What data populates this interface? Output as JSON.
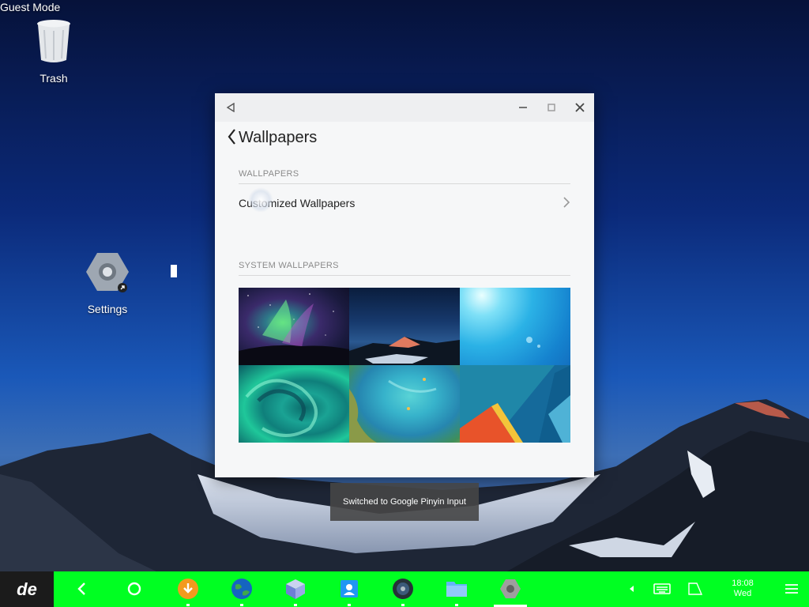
{
  "desktop": {
    "mode_label": "Guest Mode",
    "icons": [
      {
        "name": "trash",
        "label": "Trash"
      },
      {
        "name": "settings",
        "label": "Settings"
      }
    ]
  },
  "window": {
    "page_title": "Wallpapers",
    "sections": {
      "wallpapers_label": "WALLPAPERS",
      "customized_label": "Customized Wallpapers",
      "system_label": "SYSTEM WALLPAPERS"
    },
    "thumbnails": [
      "aurora-night",
      "mountain-sunset",
      "blue-sky-flare",
      "teal-wave",
      "ocean-aerial",
      "material-geometric"
    ]
  },
  "toast": {
    "text": "Switched to Google Pinyin Input"
  },
  "taskbar": {
    "start_label": "de",
    "apps": [
      "back-arrow",
      "home-circle",
      "download",
      "browser-globe",
      "cube-app",
      "contacts",
      "music-player",
      "file-manager",
      "settings-gear"
    ],
    "clock": {
      "time": "18:08",
      "day": "Wed"
    }
  }
}
